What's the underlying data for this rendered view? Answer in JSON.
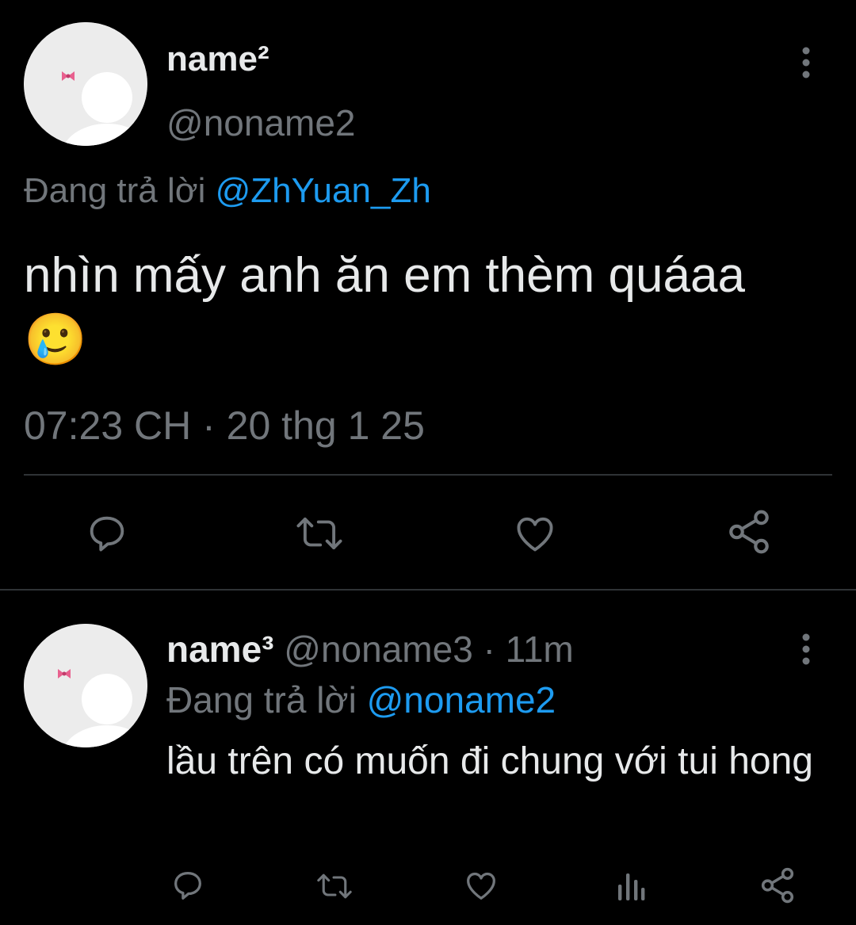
{
  "tweet": {
    "display_name": "name²",
    "handle": "@noname2",
    "replying_prefix": "Đang trả lời",
    "replying_to": "@ZhYuan_Zh",
    "text": "nhìn mấy anh ăn em thèm quáaa",
    "emoji": "🥲",
    "timestamp": "07:23 CH · 20 thg 1 25",
    "actions": [
      "reply-icon",
      "retweet-icon",
      "like-icon",
      "share-icon"
    ]
  },
  "reply": {
    "display_name": "name³",
    "handle": "@noname3",
    "separator": "·",
    "age": "11m",
    "replying_prefix": "Đang trả lời",
    "replying_to": "@noname2",
    "text": "lầu trên có muốn đi chung với tui hong",
    "actions": [
      "reply-icon",
      "retweet-icon",
      "like-icon",
      "views-icon",
      "share-icon"
    ]
  },
  "colors": {
    "background": "#000000",
    "text": "#e7e9ea",
    "muted": "#71767b",
    "link": "#1d9bf0",
    "divider": "#2f3336",
    "avatar_bg": "#ececec",
    "bow": "#e8608e"
  }
}
